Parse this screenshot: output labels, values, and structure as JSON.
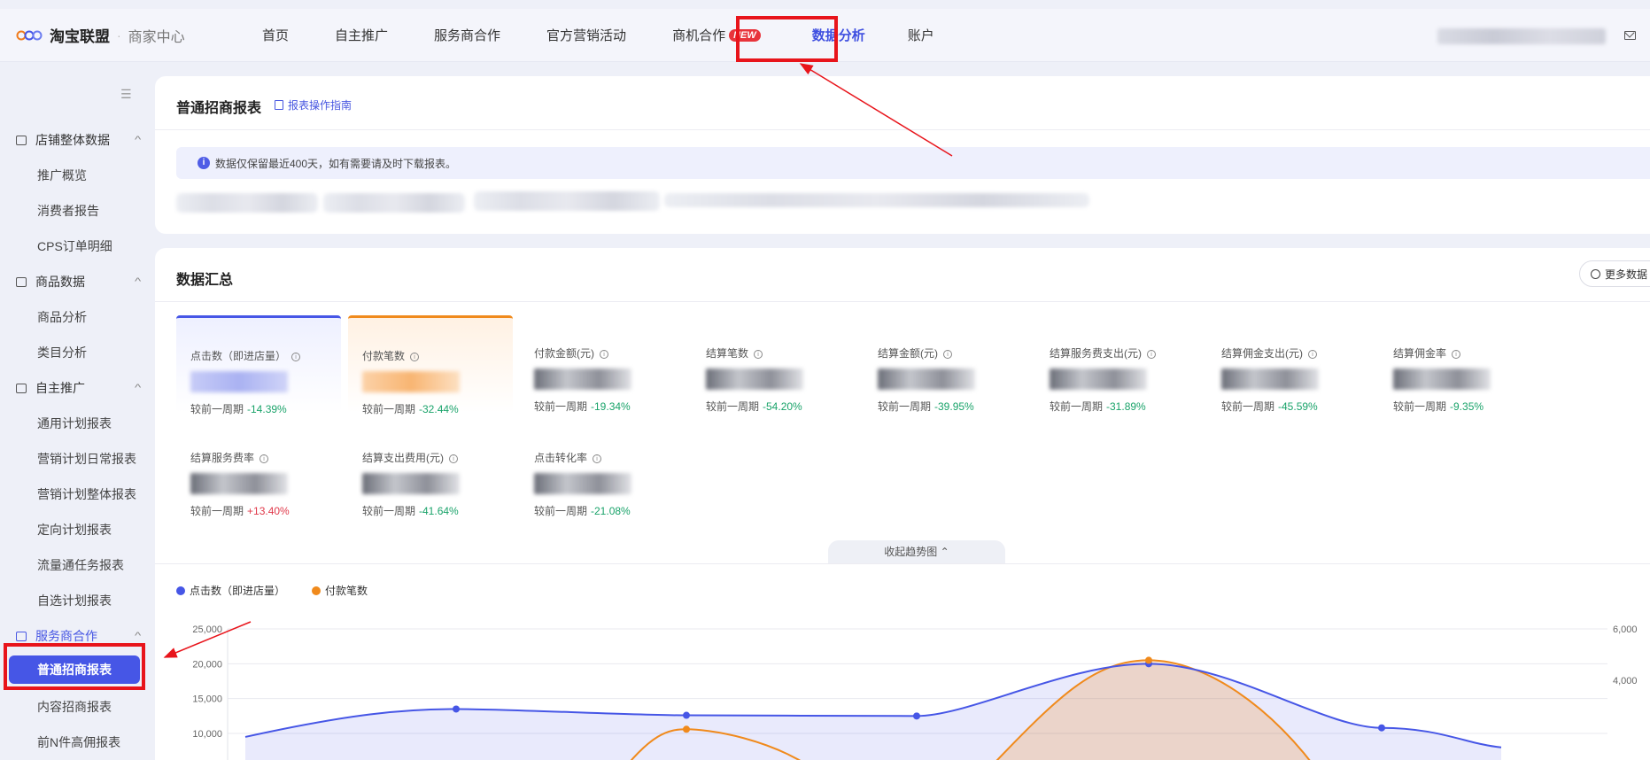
{
  "topbar": {
    "brand": "淘宝联盟",
    "sub": "商家中心",
    "nav": [
      "首页",
      "自主推广",
      "服务商合作",
      "官方营销活动",
      "商机合作",
      "数据分析",
      "账户"
    ],
    "new_badge": "NEW",
    "active": "数据分析"
  },
  "sidebar": {
    "groups": [
      {
        "label": "店铺整体数据",
        "items": [
          "推广概览",
          "消费者报告",
          "CPS订单明细"
        ]
      },
      {
        "label": "商品数据",
        "items": [
          "商品分析",
          "类目分析"
        ]
      },
      {
        "label": "自主推广",
        "items": [
          "通用计划报表",
          "营销计划日常报表",
          "营销计划整体报表",
          "定向计划报表",
          "流量通任务报表",
          "自选计划报表"
        ]
      },
      {
        "label": "服务商合作",
        "items": [
          "普通招商报表",
          "内容招商报表",
          "前N件高佣报表"
        ]
      }
    ],
    "active_item": "普通招商报表"
  },
  "report": {
    "title": "普通招商报表",
    "guide": "报表操作指南",
    "notice": "数据仅保留最近400天，如有需要请及时下载报表。"
  },
  "summary": {
    "title": "数据汇总",
    "more": "更多数据",
    "compare_prefix": "较前一周期",
    "metrics": [
      {
        "label": "点击数（即进店量）",
        "change": "-14.39%",
        "dir": "down"
      },
      {
        "label": "付款笔数",
        "change": "-32.44%",
        "dir": "down"
      },
      {
        "label": "付款金额(元)",
        "change": "-19.34%",
        "dir": "down"
      },
      {
        "label": "结算笔数",
        "change": "-54.20%",
        "dir": "down"
      },
      {
        "label": "结算金额(元)",
        "change": "-39.95%",
        "dir": "down"
      },
      {
        "label": "结算服务费支出(元)",
        "change": "-31.89%",
        "dir": "down"
      },
      {
        "label": "结算佣金支出(元)",
        "change": "-45.59%",
        "dir": "down"
      },
      {
        "label": "结算佣金率",
        "change": "-9.35%",
        "dir": "down"
      },
      {
        "label": "结算服务费率",
        "change": "+13.40%",
        "dir": "up"
      },
      {
        "label": "结算支出费用(元)",
        "change": "-41.64%",
        "dir": "down"
      },
      {
        "label": "点击转化率",
        "change": "-21.08%",
        "dir": "down"
      }
    ],
    "collapse_trend": "收起趋势图"
  },
  "chart_data": {
    "type": "area",
    "series": [
      {
        "name": "点击数（即进店量）",
        "color": "#4656e6",
        "values": [
          13500,
          12600,
          12500,
          20000,
          10800
        ]
      },
      {
        "name": "付款笔数",
        "color": "#f08a1c",
        "values": [
          10600,
          20500
        ]
      }
    ],
    "y_left_ticks": [
      "25,000",
      "20,000",
      "15,000",
      "10,000"
    ],
    "y_right_ticks": [
      "6,000",
      "4,000"
    ],
    "ylim_left": [
      10000,
      25000
    ]
  },
  "colors": {
    "accent": "#4656e6",
    "orange": "#f08a1c",
    "highlight": "#e8141b",
    "positive": "#1aa36a",
    "negative": "#e0394a"
  }
}
